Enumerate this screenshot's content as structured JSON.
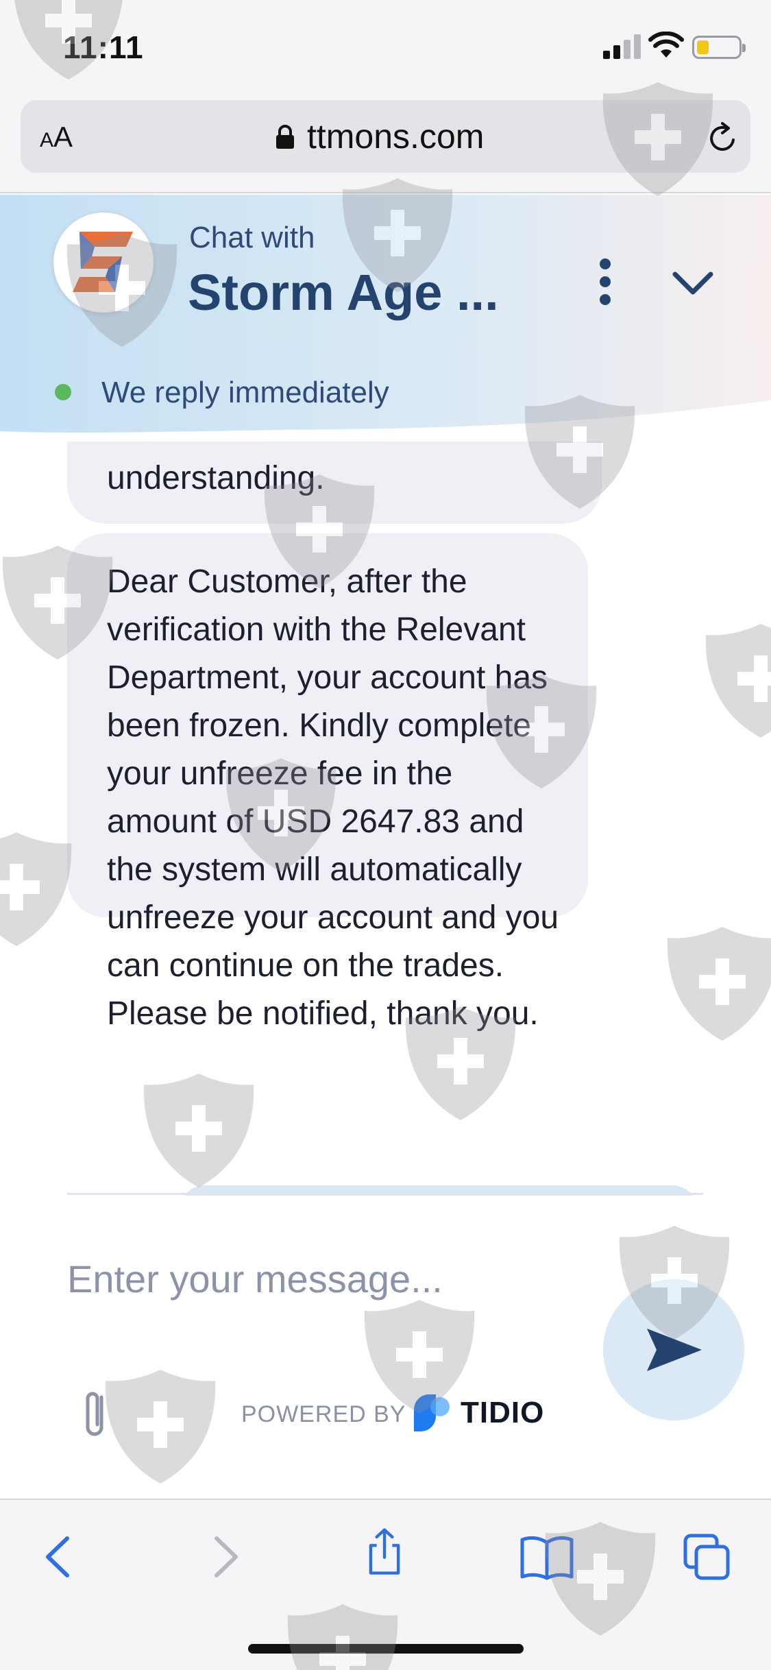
{
  "status_bar": {
    "time": "11:11"
  },
  "browser": {
    "text_size_label": "AA",
    "url": "ttmons.com"
  },
  "chat": {
    "header": {
      "subtitle": "Chat with",
      "agent_name": "Storm Age ...",
      "status": "We reply immediately",
      "online_color": "#5cb85c"
    },
    "messages": [
      {
        "text": "understanding."
      },
      {
        "text": "Dear Customer, after the verification with the Relevant Department, your account has been frozen. Kindly complete your unfreeze fee in the amount of USD 2647.83 and the system will automatically unfreeze your account and you can continue on the trades. Please be notified, thank you."
      }
    ],
    "composer": {
      "placeholder": "Enter your message...",
      "powered_by": "POWERED BY",
      "brand": "TIDIO"
    }
  },
  "colors": {
    "header_blue": "#c9e2f5",
    "header_text": "#24436f",
    "bubble": "#efeff5",
    "send_button": "#dbe9f7"
  },
  "icons": [
    "signal-icon",
    "wifi-icon",
    "battery-icon",
    "lock-icon",
    "reload-icon",
    "more-icon",
    "chevron-down-icon",
    "send-icon",
    "paperclip-icon",
    "back-icon",
    "forward-icon",
    "share-icon",
    "bookmarks-icon",
    "tabs-icon"
  ]
}
